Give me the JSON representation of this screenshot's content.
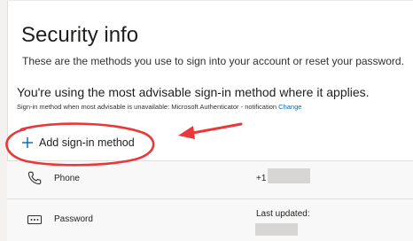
{
  "page": {
    "title": "Security info",
    "subtitle": "These are the methods you use to sign into your account or reset your password.",
    "advisable_message": "You're using the most advisable sign-in method where it applies.",
    "default_method_text": "Sign-in method when most advisable is unavailable: Microsoft Authenticator - notification",
    "change_link": "Change"
  },
  "add_method": {
    "label": "Add sign-in method",
    "icon": "plus-icon"
  },
  "methods": [
    {
      "icon": "phone-icon",
      "label": "Phone",
      "value": "+1"
    },
    {
      "icon": "password-icon",
      "label": "Password",
      "value": "Last updated:"
    }
  ],
  "colors": {
    "accent": "#0067b8",
    "annotation": "#e8383a"
  }
}
